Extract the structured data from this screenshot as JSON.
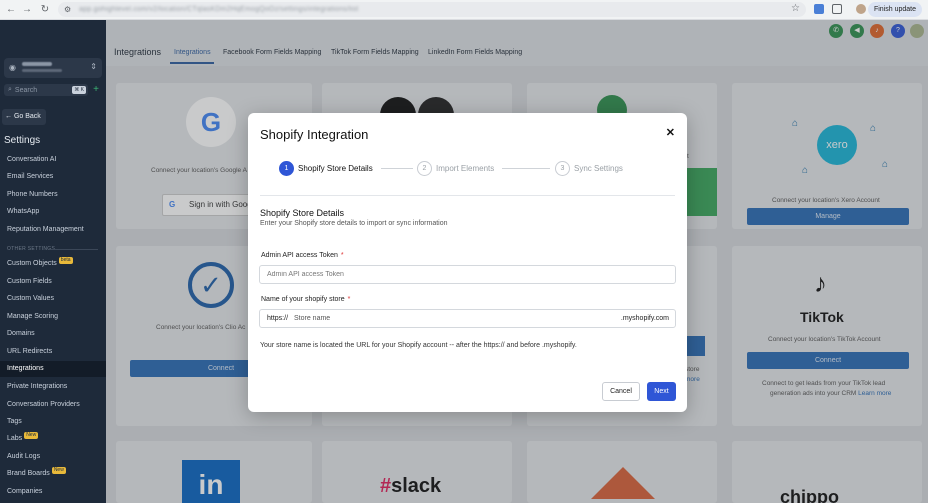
{
  "browser": {
    "url": "app.gohighlevel.com/v2/location/CTqlasKDm2HqEmogQoOz/settings/integrations/list",
    "finish_update": "Finish update"
  },
  "sidebar": {
    "search_placeholder": "Search",
    "search_shortcut": "⌘ K",
    "go_back": "Go Back",
    "settings_title": "Settings",
    "items_top": [
      {
        "label": "Conversation AI"
      },
      {
        "label": "Email Services"
      },
      {
        "label": "Phone Numbers"
      },
      {
        "label": "WhatsApp"
      },
      {
        "label": "Reputation Management"
      }
    ],
    "other_settings": "OTHER SETTINGS",
    "items_bottom": [
      {
        "label": "Custom Objects",
        "badge": "beta"
      },
      {
        "label": "Custom Fields"
      },
      {
        "label": "Custom Values"
      },
      {
        "label": "Manage Scoring"
      },
      {
        "label": "Domains"
      },
      {
        "label": "URL Redirects"
      },
      {
        "label": "Integrations",
        "active": true
      },
      {
        "label": "Private Integrations"
      },
      {
        "label": "Conversation Providers"
      },
      {
        "label": "Tags"
      },
      {
        "label": "Labs",
        "badge": "New"
      },
      {
        "label": "Audit Logs"
      },
      {
        "label": "Brand Boards",
        "badge": "New"
      },
      {
        "label": "Companies"
      }
    ]
  },
  "header": {
    "title": "Integrations",
    "tabs": [
      {
        "label": "Integrations",
        "active": true
      },
      {
        "label": "Facebook Form Fields Mapping"
      },
      {
        "label": "TikTok Form Fields Mapping"
      },
      {
        "label": "LinkedIn Form Fields Mapping"
      }
    ],
    "help_icon": "?",
    "colors": {
      "phone": "#2f8f4e",
      "megaphone": "#2f8f4e",
      "bell": "#e0662a",
      "help": "#2f56d6"
    }
  },
  "cards": {
    "google_text": "Connect your location's Google A",
    "google_button": "Sign in with Goog",
    "clio_text": "Connect your location's Clio Ac",
    "clio_button": "Connect",
    "xero_brand": "xero",
    "xero_text": "Connect your location's Xero Account",
    "xero_button": "Manage",
    "tiktok_brand": "TikTok",
    "tiktok_text": "Connect your location's TikTok Account",
    "tiktok_button": "Connect",
    "tiktok_desc_1": "Connect to get leads from your TikTok lead",
    "tiktok_desc_2": "generation ads into your CRM",
    "tiktok_more": "Learn more",
    "partial_store": "store",
    "partial_more": "more",
    "partial_t": "t",
    "linkedin_brand": "in",
    "slack_brand": "slack",
    "chippo_brand": "chippo"
  },
  "modal": {
    "title": "Shopify Integration",
    "steps": [
      {
        "num": "1",
        "label": "Shopify Store Details",
        "active": true
      },
      {
        "num": "2",
        "label": "Import Elements",
        "active": false
      },
      {
        "num": "3",
        "label": "Sync Settings",
        "active": false
      }
    ],
    "section_title": "Shopify Store Details",
    "section_subtitle": "Enter your Shopify store details to import or sync information",
    "token_label": "Admin API access Token",
    "token_placeholder": "Admin API access Token",
    "store_label": "Name of your shopify store",
    "store_prefix": "https://",
    "store_placeholder": "Store name",
    "store_suffix": ".myshopify.com",
    "help_text": "Your store name is located the URL for your Shopify account -- after the https:// and before .myshopify.",
    "required_mark": "*",
    "cancel": "Cancel",
    "next": "Next",
    "accent": "#2f56d6"
  }
}
